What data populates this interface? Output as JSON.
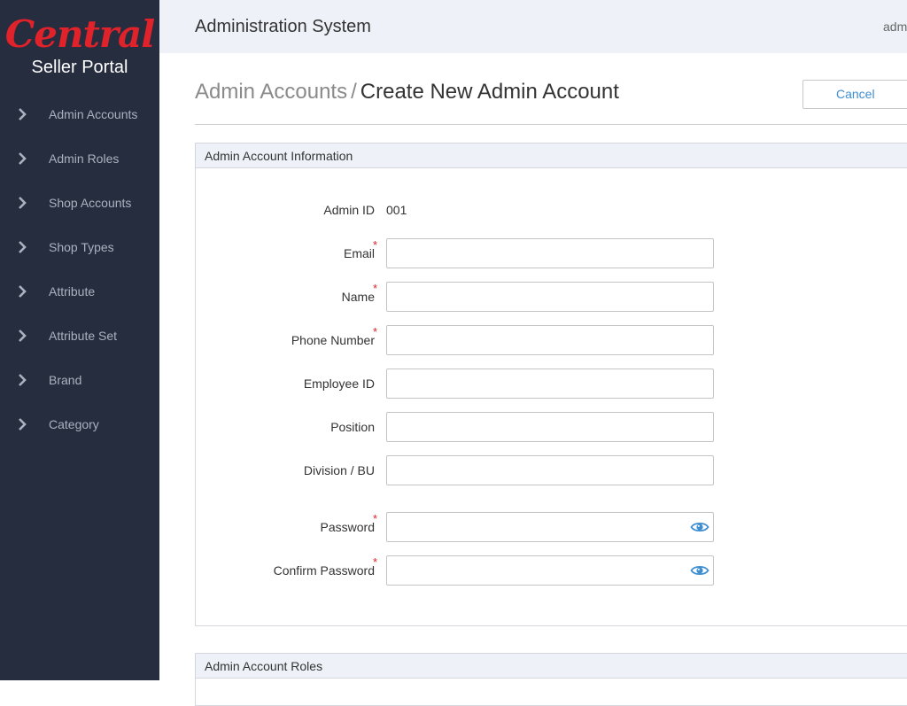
{
  "brand": {
    "logo_text": "Central",
    "subtitle": "Seller Portal",
    "logo_color": "#e0222b"
  },
  "sidebar": {
    "items": [
      {
        "label": "Admin Accounts",
        "icon": "chevron-right-icon"
      },
      {
        "label": "Admin Roles",
        "icon": "chevron-right-icon"
      },
      {
        "label": "Shop Accounts",
        "icon": "chevron-right-icon"
      },
      {
        "label": "Shop Types",
        "icon": "chevron-right-icon"
      },
      {
        "label": "Attribute",
        "icon": "chevron-right-icon"
      },
      {
        "label": "Attribute Set",
        "icon": "chevron-right-icon"
      },
      {
        "label": "Brand",
        "icon": "chevron-right-icon"
      },
      {
        "label": "Category",
        "icon": "chevron-right-icon"
      }
    ]
  },
  "header": {
    "title": "Administration System",
    "user": "adm"
  },
  "page": {
    "breadcrumb_parent": "Admin Accounts",
    "breadcrumb_separator": "/",
    "title": "Create New Admin Account",
    "cancel_label": "Cancel"
  },
  "info_panel": {
    "title": "Admin Account Information",
    "admin_id_label": "Admin ID",
    "admin_id_value": "001",
    "fields": [
      {
        "label": "Email",
        "required": true,
        "value": "",
        "placeholder": ""
      },
      {
        "label": "Name",
        "required": true,
        "value": "",
        "placeholder": ""
      },
      {
        "label": "Phone Number",
        "required": true,
        "value": "",
        "placeholder": ""
      },
      {
        "label": "Employee ID",
        "required": false,
        "value": "",
        "placeholder": ""
      },
      {
        "label": "Position",
        "required": false,
        "value": "",
        "placeholder": ""
      },
      {
        "label": "Division / BU",
        "required": false,
        "value": "",
        "placeholder": ""
      },
      {
        "label": "Password",
        "required": true,
        "value": "",
        "placeholder": "",
        "icon": "eye-icon"
      },
      {
        "label": "Confirm Password",
        "required": true,
        "value": "",
        "placeholder": "",
        "icon": "eye-icon"
      }
    ],
    "required_mark": "*"
  },
  "roles_panel": {
    "title": "Admin Account Roles"
  },
  "colors": {
    "sidebar_bg": "#262d3f",
    "header_bg": "#eef2f8",
    "accent": "#3e8ed0",
    "required": "#e0222b"
  }
}
